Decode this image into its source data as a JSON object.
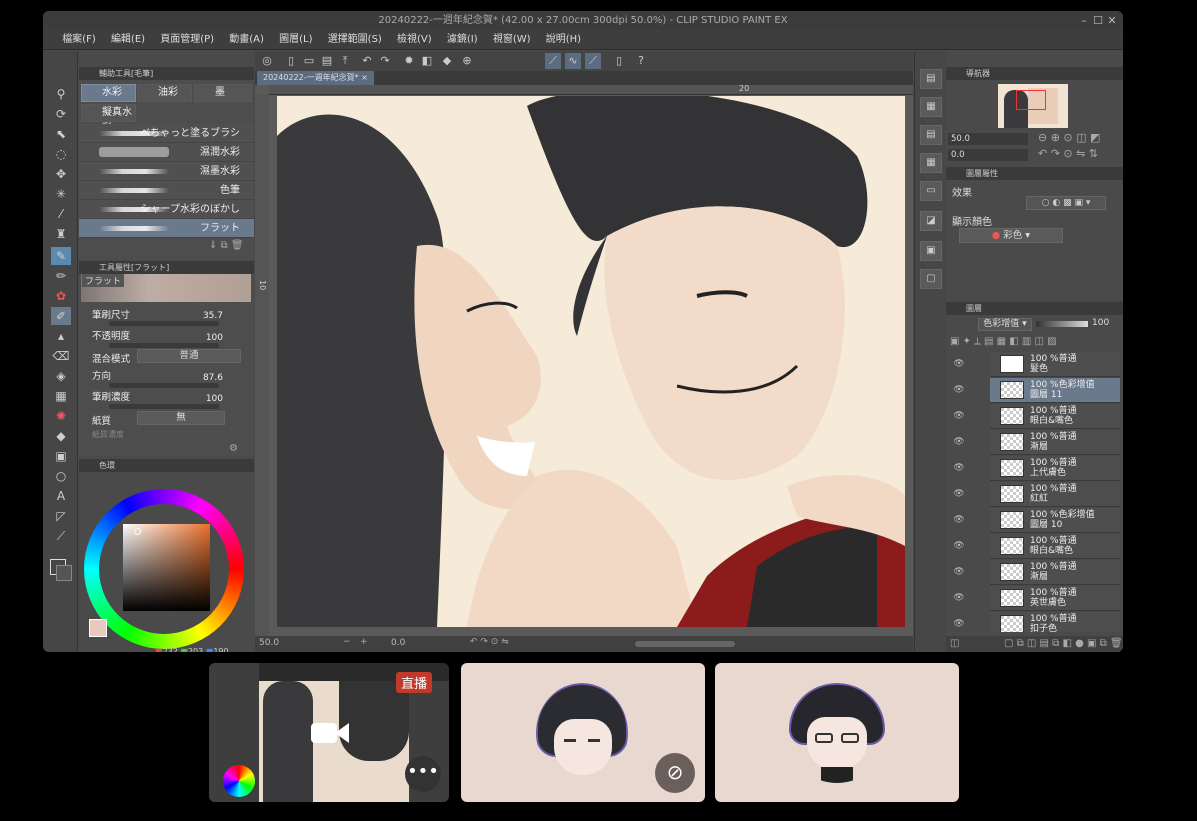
{
  "window": {
    "title": "20240222-一週年紀念賀* (42.00 x 27.00cm 300dpi 50.0%) - CLIP STUDIO PAINT EX"
  },
  "menu": [
    "檔案(F)",
    "編輯(E)",
    "頁面管理(P)",
    "動畫(A)",
    "圖層(L)",
    "選擇範圍(S)",
    "檢視(V)",
    "濾鏡(I)",
    "視窗(W)",
    "說明(H)"
  ],
  "subtool": {
    "header": "輔助工具[毛筆]",
    "tabs": [
      "水彩",
      "油彩",
      "墨",
      "擬真水彩"
    ],
    "brushes": [
      "べちゃっと塗るブラシ",
      "濕潤水彩",
      "濕墨水彩",
      "色筆",
      "シャープ水彩のぼかし",
      "フラット"
    ]
  },
  "toolprop": {
    "header": "工具屬性[フラット]",
    "brush_name": "フラット",
    "rows": [
      {
        "label": "筆刷尺寸",
        "value": "35.7"
      },
      {
        "label": "不透明度",
        "value": "100"
      },
      {
        "label": "混合模式",
        "value": "普通"
      },
      {
        "label": "方向",
        "value": "87.6"
      },
      {
        "label": "筆刷濃度",
        "value": "100"
      },
      {
        "label": "紙質",
        "value": "無"
      },
      {
        "label": "紙質濃度",
        "value": ""
      }
    ]
  },
  "color": {
    "tab": "色環",
    "rgb": {
      "r": "232",
      "g": "203",
      "b": "190"
    },
    "main_color": "#e8cbbe",
    "hue_color": "#e8702a"
  },
  "canvas": {
    "doc_tab": "20240222-一週年紀念賀*",
    "ruler_top_mark": "20",
    "ruler_left_mark": "10",
    "zoom": "50.0",
    "angle": "0.0"
  },
  "navigator": {
    "header": "導航器",
    "zoom": "50.0",
    "angle": "0.0"
  },
  "layer_property": {
    "header": "圖層屬性",
    "effect_label": "效果",
    "display_color_label": "顯示顏色",
    "display_color_value": "彩色"
  },
  "layers": {
    "header": "圖層",
    "blend_mode": "色彩增值",
    "opacity": "100",
    "items": [
      {
        "mode": "100 %普通",
        "name": "髮色"
      },
      {
        "mode": "100 %色彩增值",
        "name": "圖層 11"
      },
      {
        "mode": "100 %普通",
        "name": "眼白&嘴色"
      },
      {
        "mode": "100 %普通",
        "name": "漸層"
      },
      {
        "mode": "100 %普通",
        "name": "上代膚色"
      },
      {
        "mode": "100 %普通",
        "name": "紅紅"
      },
      {
        "mode": "100 %色彩增值",
        "name": "圖層 10"
      },
      {
        "mode": "100 %普通",
        "name": "眼白&嘴色"
      },
      {
        "mode": "100 %普通",
        "name": "漸層"
      },
      {
        "mode": "100 %普通",
        "name": "英世膚色"
      },
      {
        "mode": "100 %普通",
        "name": "扣子色"
      }
    ]
  },
  "call": {
    "live_badge": "直播"
  }
}
